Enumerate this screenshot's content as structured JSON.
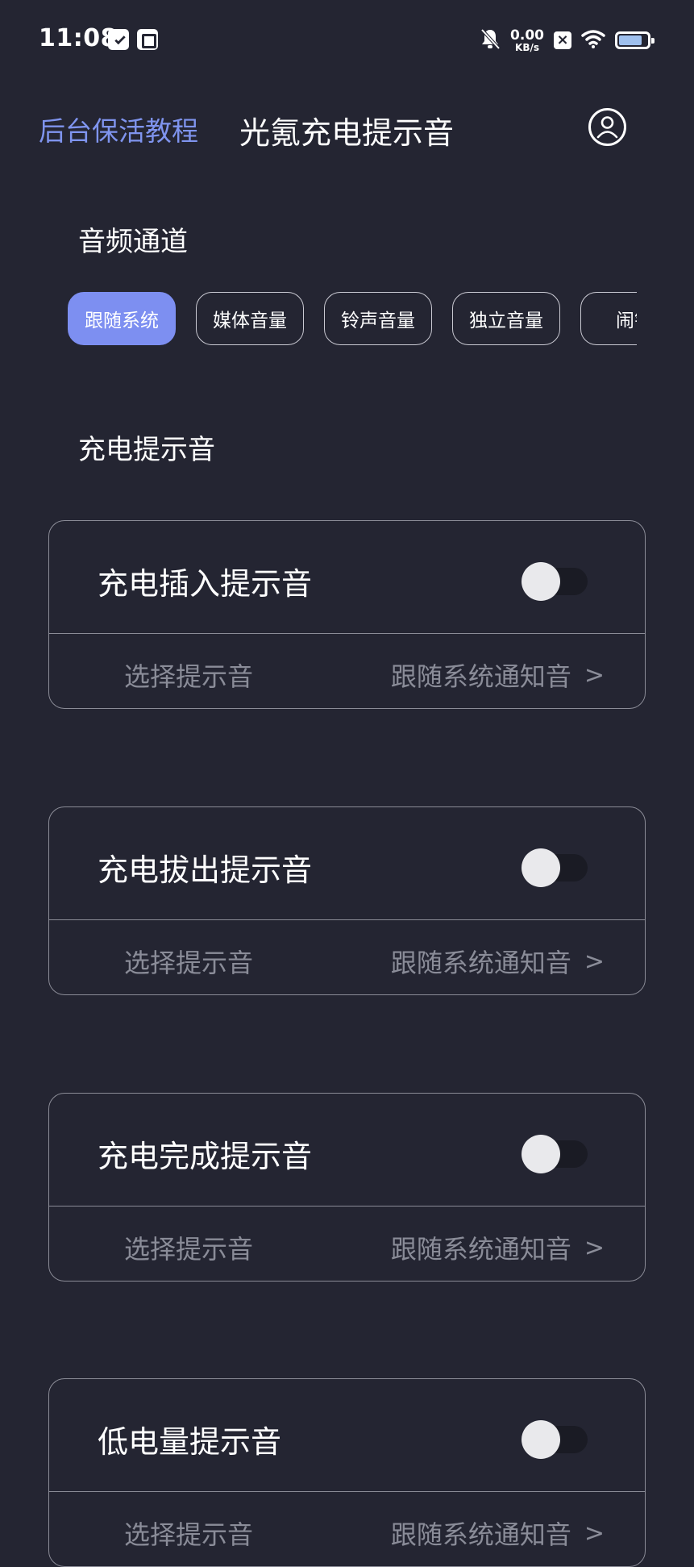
{
  "status_bar": {
    "time": "11:08",
    "net_speed_value": "0.00",
    "net_speed_unit": "KB/s",
    "battery_level": 0.85
  },
  "header": {
    "tutorial_link": "后台保活教程",
    "title": "光氪充电提示音"
  },
  "audio_channel": {
    "heading": "音频通道",
    "chips": [
      {
        "label": "跟随系统",
        "active": true
      },
      {
        "label": "媒体音量",
        "active": false
      },
      {
        "label": "铃声音量",
        "active": false
      },
      {
        "label": "独立音量",
        "active": false
      },
      {
        "label": "闹钟",
        "active": false
      }
    ]
  },
  "charge_sounds": {
    "heading": "充电提示音",
    "cards": [
      {
        "title": "充电插入提示音",
        "enabled": false,
        "pick_label": "选择提示音",
        "pick_value": "跟随系统通知音",
        "chevron": ">"
      },
      {
        "title": "充电拔出提示音",
        "enabled": false,
        "pick_label": "选择提示音",
        "pick_value": "跟随系统通知音",
        "chevron": ">"
      },
      {
        "title": "充电完成提示音",
        "enabled": false,
        "pick_label": "选择提示音",
        "pick_value": "跟随系统通知音",
        "chevron": ">"
      },
      {
        "title": "低电量提示音",
        "enabled": false,
        "pick_label": "选择提示音",
        "pick_value": "跟随系统通知音",
        "chevron": ">"
      }
    ]
  },
  "colors": {
    "background": "#242532",
    "accent": "#7d8ff1",
    "tutorial_link": "#7f94ee",
    "muted_text": "#8a8c98"
  },
  "icons": {
    "status_left": [
      "message-icon",
      "notes-icon"
    ],
    "status_right": [
      "bell-off-icon",
      "close-box-icon",
      "wifi-icon",
      "battery-icon"
    ],
    "header_right": "user-icon"
  }
}
